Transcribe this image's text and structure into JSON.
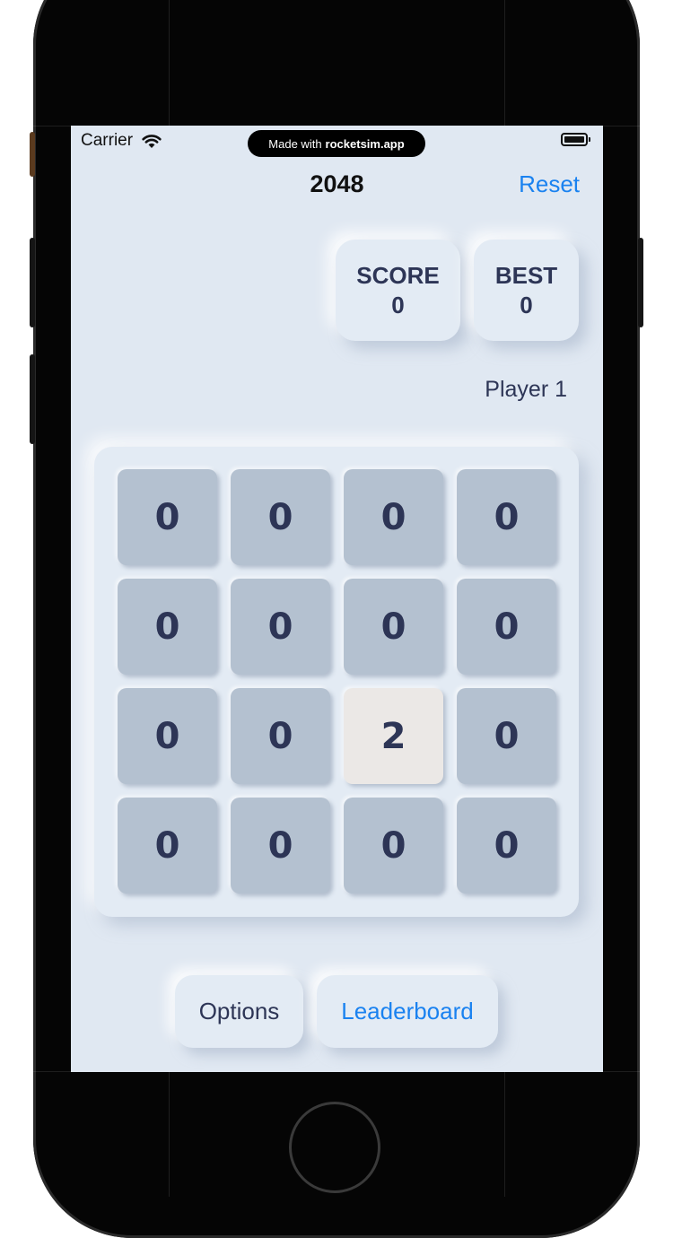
{
  "status_bar": {
    "carrier": "Carrier",
    "made_with_prefix": "Made with",
    "made_with_brand": "rocketsim.app"
  },
  "nav": {
    "title": "2048",
    "reset_label": "Reset",
    "accent_color": "#1a82f0"
  },
  "scores": {
    "score_label": "SCORE",
    "score_value": "0",
    "best_label": "BEST",
    "best_value": "0"
  },
  "player": {
    "name": "Player 1"
  },
  "board": {
    "rows": [
      [
        "0",
        "0",
        "0",
        "0"
      ],
      [
        "0",
        "0",
        "0",
        "0"
      ],
      [
        "0",
        "0",
        "2",
        "0"
      ],
      [
        "0",
        "0",
        "0",
        "0"
      ]
    ]
  },
  "actions": {
    "options_label": "Options",
    "leaderboard_label": "Leaderboard"
  }
}
